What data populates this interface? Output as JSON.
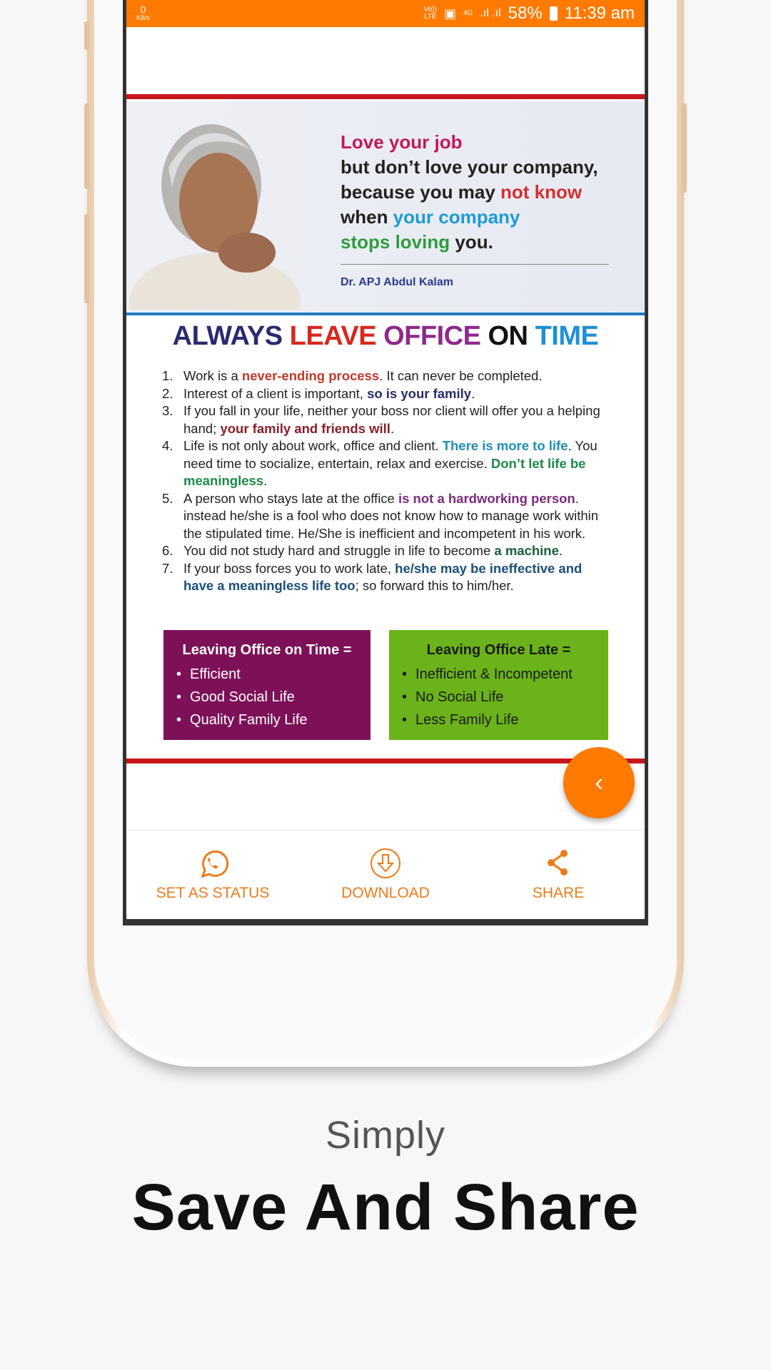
{
  "status_bar": {
    "speed_value": "0",
    "speed_unit": "KB/s",
    "volte": "Vo))",
    "lte": "LTE",
    "network": "4G",
    "battery": "58%",
    "time": "11:39 am"
  },
  "quote": {
    "lines": [
      [
        {
          "t": "Love your job",
          "c": "#c2185b"
        }
      ],
      [
        {
          "t": "but don’t love your company,",
          "c": "#222"
        }
      ],
      [
        {
          "t": "because you may ",
          "c": "#222"
        },
        {
          "t": "not know",
          "c": "#d32f2f"
        }
      ],
      [
        {
          "t": "when ",
          "c": "#222"
        },
        {
          "t": "your company",
          "c": "#1e9ad6"
        }
      ],
      [
        {
          "t": "stops loving",
          "c": "#2e9c3e"
        },
        {
          "t": " you.",
          "c": "#222"
        }
      ]
    ],
    "author": "Dr. APJ Abdul Kalam"
  },
  "poster_title": [
    {
      "t": "ALWAYS ",
      "c": "#2b2a6e"
    },
    {
      "t": "LEAVE ",
      "c": "#d8281d"
    },
    {
      "t": "OFFICE ",
      "c": "#8e2a8c"
    },
    {
      "t": "ON ",
      "c": "#111"
    },
    {
      "t": "TIME",
      "c": "#1e90d6"
    }
  ],
  "list": [
    {
      "n": "1.",
      "parts": [
        {
          "t": "Work is a "
        },
        {
          "t": "never-ending process",
          "c": "#c0392b"
        },
        {
          "t": ". It can never be completed."
        }
      ]
    },
    {
      "n": "2.",
      "parts": [
        {
          "t": "Interest of a client is important, "
        },
        {
          "t": "so is your family",
          "c": "#2b2a6e"
        },
        {
          "t": "."
        }
      ]
    },
    {
      "n": "3.",
      "parts": [
        {
          "t": "If you fall in your life, neither your boss nor client will offer you a helping hand; "
        },
        {
          "t": "your family and friends will",
          "c": "#8b1e2b"
        },
        {
          "t": "."
        }
      ]
    },
    {
      "n": "4.",
      "parts": [
        {
          "t": "Life is not only about work, office and client. "
        },
        {
          "t": "There is more to life",
          "c": "#1f8fb8"
        },
        {
          "t": ". You need time to socialize, entertain, relax and exercise. "
        },
        {
          "t": "Don’t let life be meaningless",
          "c": "#1b8a4a"
        },
        {
          "t": "."
        }
      ]
    },
    {
      "n": "5.",
      "parts": [
        {
          "t": "A person who stays late at the office "
        },
        {
          "t": "is not a hardworking person",
          "c": "#7b2a7e"
        },
        {
          "t": ". instead he/she is a fool who does not know how to manage work within the stipulated time. He/She is inefficient and incompetent in his work."
        }
      ]
    },
    {
      "n": "6.",
      "parts": [
        {
          "t": "You did not study hard and struggle in life to become "
        },
        {
          "t": "a machine",
          "c": "#1b5e3a"
        },
        {
          "t": "."
        }
      ]
    },
    {
      "n": "7.",
      "parts": [
        {
          "t": "If your boss forces you to work late, "
        },
        {
          "t": "he/she may be ineffective and have a meaningless life too",
          "c": "#1a4f7a"
        },
        {
          "t": "; so forward this to him/her."
        }
      ]
    }
  ],
  "box_on_time": {
    "heading": "Leaving Office on Time =",
    "items": [
      "Efficient",
      "Good Social Life",
      "Quality Family Life"
    ],
    "color": "#7d1157"
  },
  "box_late": {
    "heading": "Leaving Office Late =",
    "items": [
      "Inefficient & Incompetent",
      "No Social Life",
      "Less Family Life"
    ],
    "color": "#6bb31a"
  },
  "fab": {
    "icon": "chevron-left-icon",
    "glyph": "‹"
  },
  "bottom_nav": [
    {
      "label": "SET AS STATUS",
      "icon": "whatsapp-icon"
    },
    {
      "label": "DOWNLOAD",
      "icon": "download-icon"
    },
    {
      "label": "SHARE",
      "icon": "share-icon"
    }
  ],
  "caption": {
    "line1": "Simply",
    "line2": "Save And Share"
  },
  "accent": "#ff7a00"
}
